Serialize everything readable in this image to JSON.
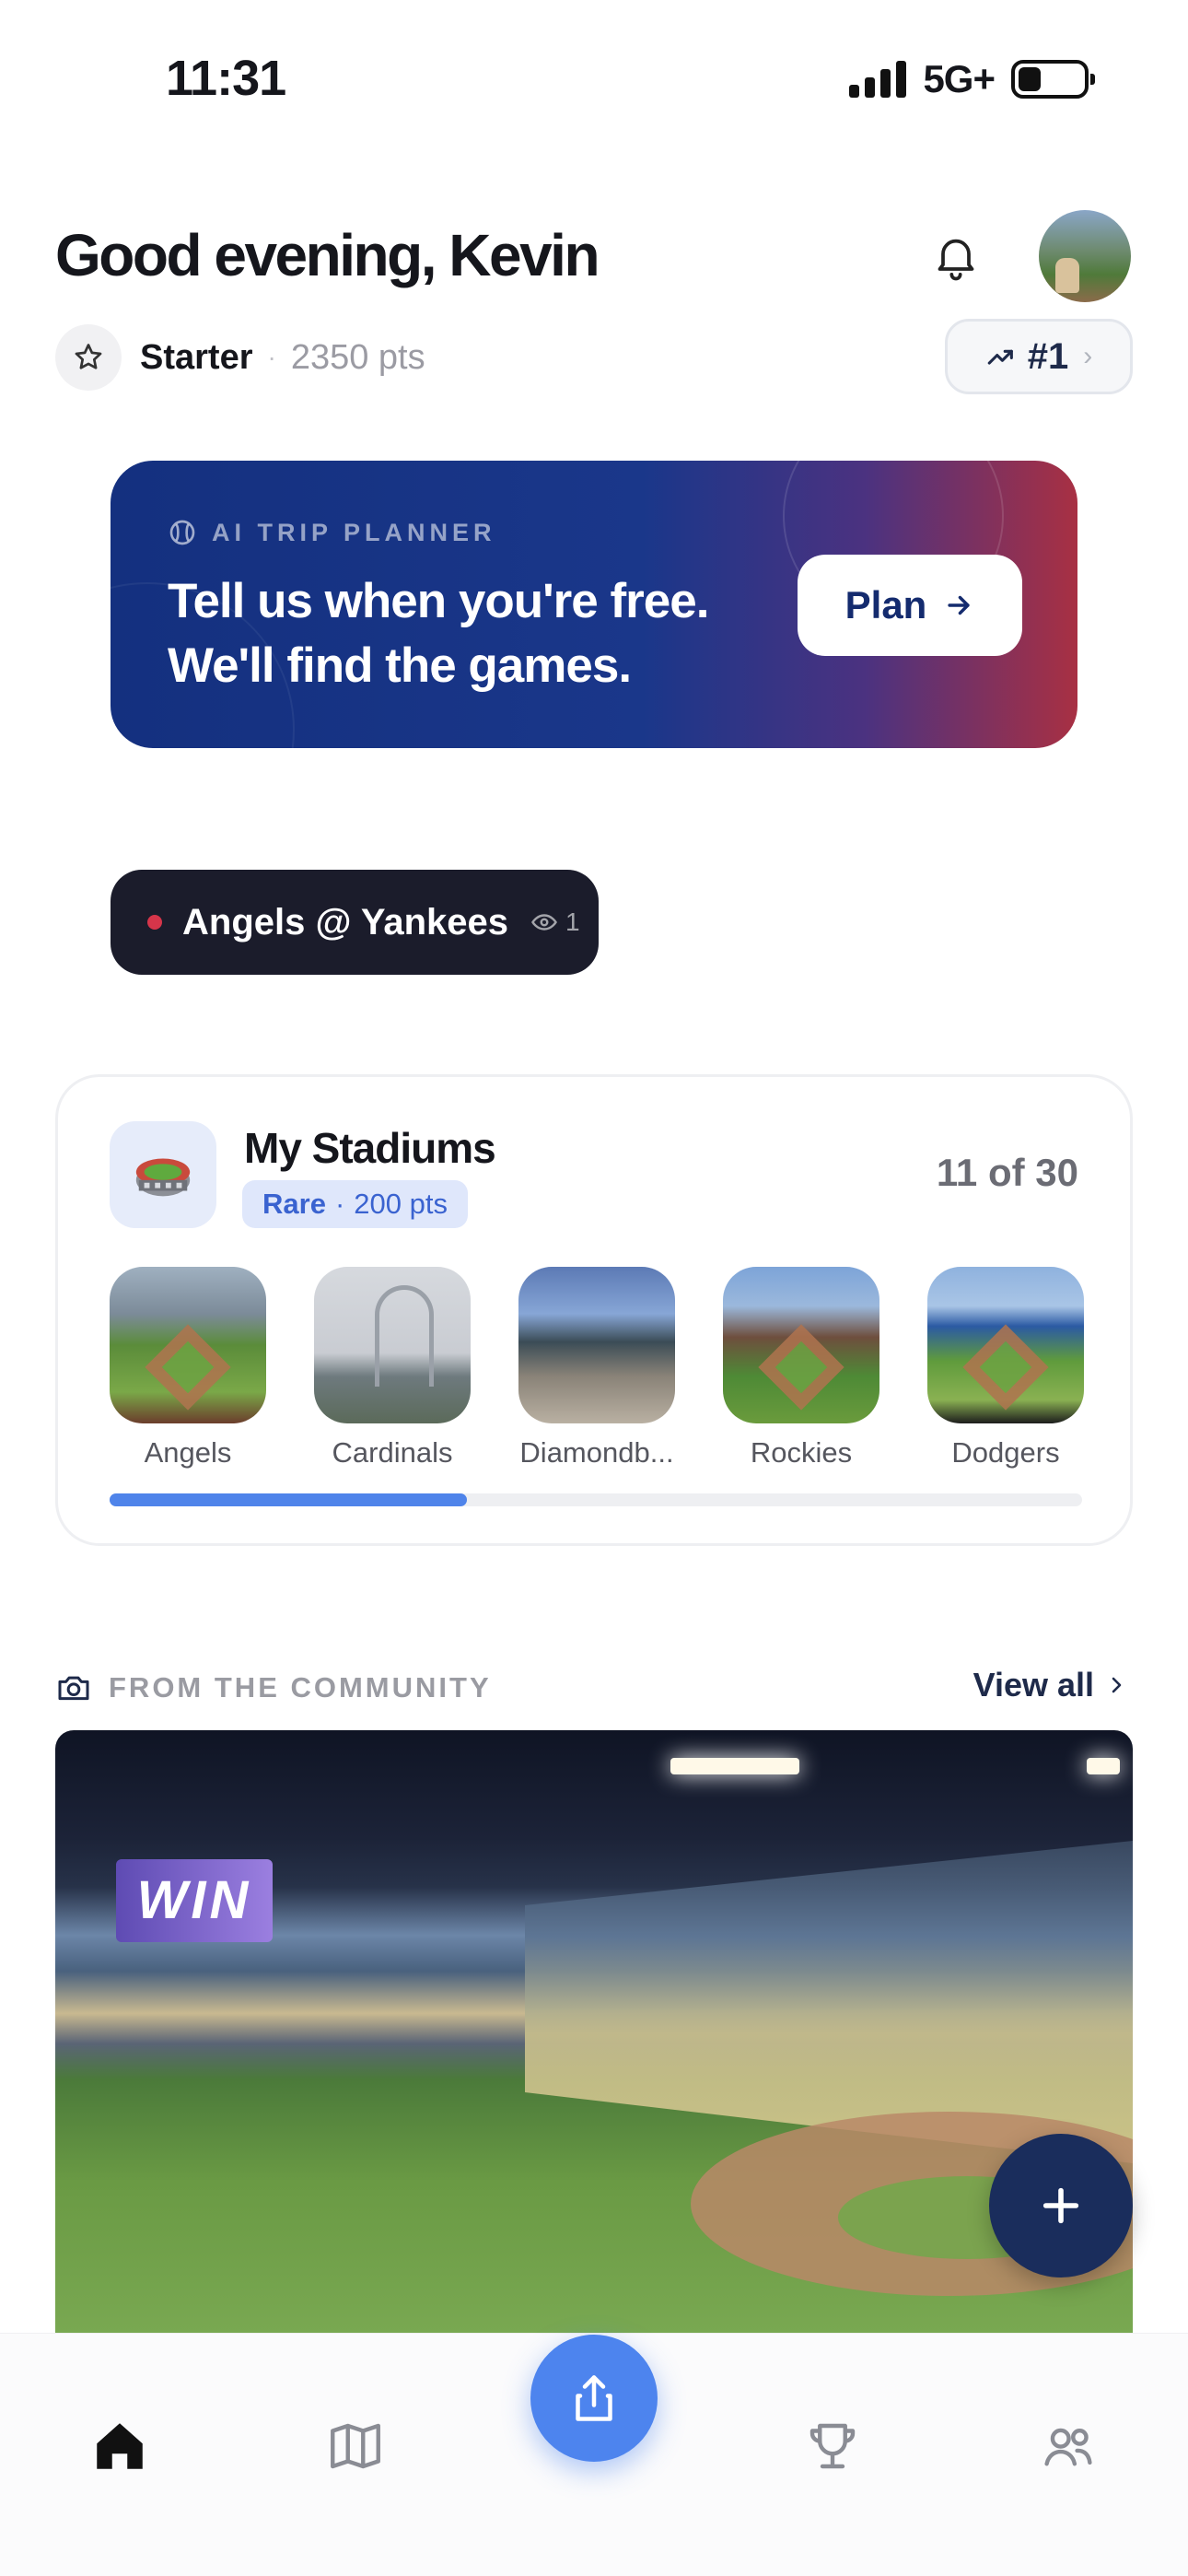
{
  "status_bar": {
    "time": "11:31",
    "network": "5G+"
  },
  "header": {
    "greeting": "Good evening, Kevin",
    "tier": "Starter",
    "separator": "·",
    "points": "2350 pts",
    "rank": "#1"
  },
  "trip_planner": {
    "label": "AI TRIP PLANNER",
    "title": "Tell us when you're free. We'll find the games.",
    "button_label": "Plan"
  },
  "live_game": {
    "title": "Angels @ Yankees",
    "viewer_count": "1",
    "dot_color": "#d6354a"
  },
  "stadiums": {
    "title": "My Stadiums",
    "rarity": "Rare",
    "rarity_separator": "·",
    "rarity_points": "200 pts",
    "count": "11 of 30",
    "items": [
      {
        "name": "Angels"
      },
      {
        "name": "Cardinals"
      },
      {
        "name": "Diamondb..."
      },
      {
        "name": "Rockies"
      },
      {
        "name": "Dodgers"
      }
    ],
    "progress": 0.367
  },
  "community": {
    "label": "FROM THE COMMUNITY",
    "view_all": "View all",
    "scoreboard_text": "WIN"
  },
  "colors": {
    "accent_blue": "#4d84ee",
    "navy": "#1a2d5c",
    "planner_start": "#14307f",
    "planner_end": "#a83043"
  },
  "tab_bar": {
    "tabs": [
      {
        "icon": "home-icon"
      },
      {
        "icon": "map-icon"
      },
      {
        "icon": "share-icon"
      },
      {
        "icon": "trophy-icon"
      },
      {
        "icon": "people-icon"
      }
    ]
  }
}
